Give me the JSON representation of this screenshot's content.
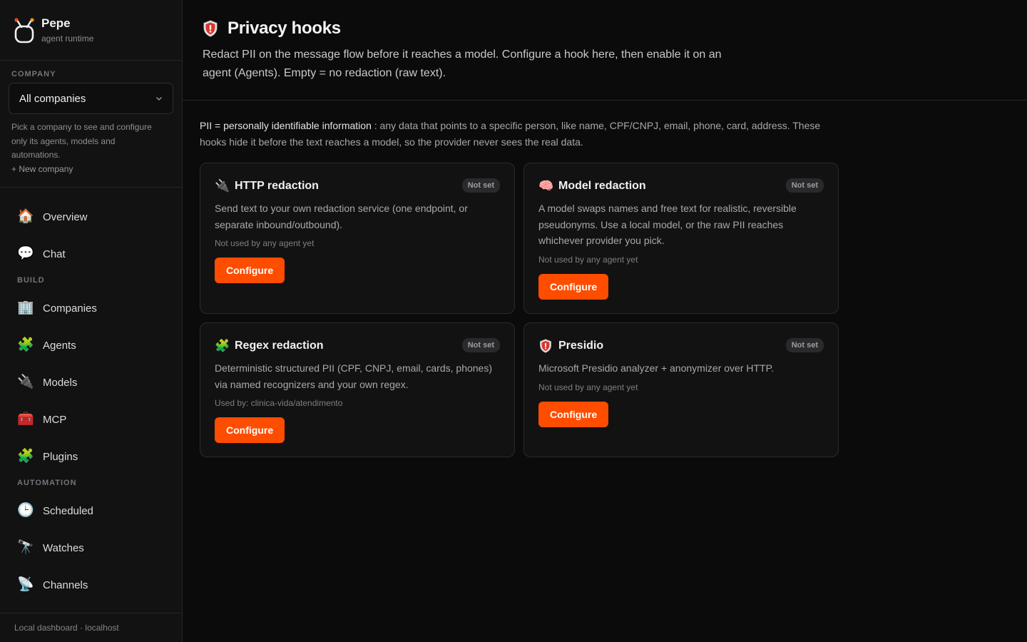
{
  "brand": {
    "name": "Pepe",
    "subtitle": "agent runtime"
  },
  "sidebar": {
    "company_label": "COMPANY",
    "company_select": {
      "value": "All companies"
    },
    "company_help": "Pick a company to see and configure only its agents, models and automations.",
    "new_company": "+ New company",
    "nav": {
      "top": [
        {
          "label": "Overview",
          "icon": "house-icon",
          "glyph": "🏠"
        },
        {
          "label": "Chat",
          "icon": "speech-bubble-icon",
          "glyph": "💬"
        }
      ],
      "build_label": "BUILD",
      "build": [
        {
          "label": "Companies",
          "icon": "office-building-icon",
          "glyph": "🏢"
        },
        {
          "label": "Agents",
          "icon": "puzzle-icon",
          "glyph": "🧩"
        },
        {
          "label": "Models",
          "icon": "plug-icon",
          "glyph": "🔌"
        },
        {
          "label": "MCP",
          "icon": "toolbox-icon",
          "glyph": "🧰"
        },
        {
          "label": "Plugins",
          "icon": "puzzle-icon",
          "glyph": "🧩"
        }
      ],
      "automation_label": "AUTOMATION",
      "automation": [
        {
          "label": "Scheduled",
          "icon": "clock-icon",
          "glyph": "🕒"
        },
        {
          "label": "Watches",
          "icon": "telescope-icon",
          "glyph": "🔭"
        },
        {
          "label": "Channels",
          "icon": "satellite-icon",
          "glyph": "📡"
        }
      ]
    },
    "footer": "Local dashboard · localhost"
  },
  "header": {
    "title": "Privacy hooks",
    "icon": "shield-icon",
    "description": "Redact PII on the message flow before it reaches a model. Configure a hook here, then enable it on an agent (Agents). Empty = no redaction (raw text)."
  },
  "pii_note": {
    "term": "PII = personally identifiable information",
    "rest": " : any data that points to a specific person, like name, CPF/CNPJ, email, phone, card, address. These hooks hide it before the text reaches a model, so the provider never sees the real data."
  },
  "cards": [
    {
      "title": "HTTP redaction",
      "icon": "plug-icon",
      "glyph": "🔌",
      "badge": "Not set",
      "description": "Send text to your own redaction service (one endpoint, or separate inbound/outbound).",
      "usage": "Not used by any agent yet",
      "button": "Configure"
    },
    {
      "title": "Model redaction",
      "icon": "brain-icon",
      "glyph": "🧠",
      "badge": "Not set",
      "description": "A model swaps names and free text for realistic, reversible pseudonyms. Use a local model, or the raw PII reaches whichever provider you pick.",
      "usage": "Not used by any agent yet",
      "button": "Configure"
    },
    {
      "title": "Regex redaction",
      "icon": "puzzle-icon",
      "glyph": "🧩",
      "badge": "Not set",
      "description": "Deterministic structured PII (CPF, CNPJ, email, cards, phones) via named recognizers and your own regex.",
      "usage": "Used by: clinica-vida/atendimento",
      "button": "Configure"
    },
    {
      "title": "Presidio",
      "icon": "shield-icon",
      "glyph": "",
      "badge": "Not set",
      "description": "Microsoft Presidio analyzer + anonymizer over HTTP.",
      "usage": "Not used by any agent yet",
      "button": "Configure"
    }
  ],
  "colors": {
    "accent": "#ff4d00",
    "background": "#0b0b0c",
    "sidebar": "#121213"
  }
}
